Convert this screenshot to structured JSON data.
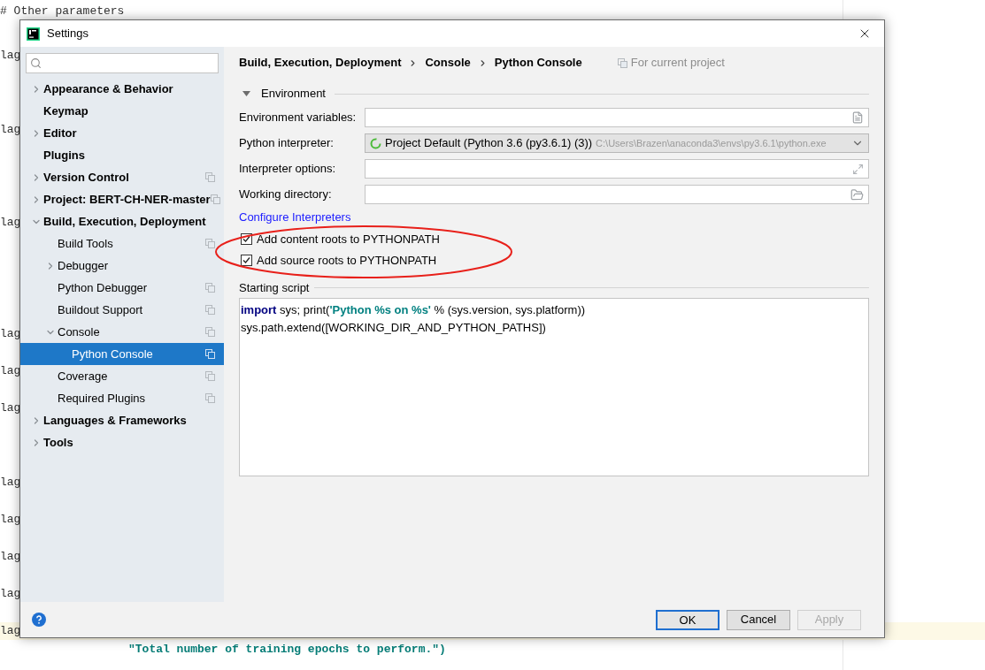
{
  "editor": {
    "lines": [
      {
        "text": "# Other parameters"
      },
      {
        "text": "lag"
      },
      {
        "text": "lag"
      },
      {
        "text": "lag"
      },
      {
        "text": "lag"
      },
      {
        "text": "lag"
      },
      {
        "text": "lag"
      },
      {
        "text": "lag"
      },
      {
        "text": "lag"
      },
      {
        "text": "lag"
      },
      {
        "text": "lag"
      },
      {
        "text": "lag",
        "current": true
      },
      {
        "text": "\"Total number of training epochs to perform.\")",
        "kind": "string"
      }
    ]
  },
  "dialog": {
    "title": "Settings",
    "sidebar": {
      "items": [
        {
          "label": "Appearance & Behavior",
          "expanded": false,
          "selected": false
        },
        {
          "label": "Keymap",
          "selected": false
        },
        {
          "label": "Editor",
          "expanded": false,
          "selected": false
        },
        {
          "label": "Plugins",
          "selected": false
        },
        {
          "label": "Version Control",
          "expanded": false,
          "project_scoped": true,
          "selected": false
        },
        {
          "label": "Project: BERT-CH-NER-master",
          "expanded": false,
          "project_scoped": true,
          "selected": false
        },
        {
          "label": "Build, Execution, Deployment",
          "expanded": true,
          "selected": false,
          "children": [
            {
              "label": "Build Tools",
              "project_scoped": true,
              "selected": false
            },
            {
              "label": "Debugger",
              "expanded": false,
              "selected": false
            },
            {
              "label": "Python Debugger",
              "project_scoped": true,
              "selected": false
            },
            {
              "label": "Buildout Support",
              "project_scoped": true,
              "selected": false
            },
            {
              "label": "Console",
              "expanded": true,
              "project_scoped": true,
              "selected": false,
              "children": [
                {
                  "label": "Python Console",
                  "project_scoped": true,
                  "selected": true
                }
              ]
            },
            {
              "label": "Coverage",
              "project_scoped": true,
              "selected": false
            },
            {
              "label": "Required Plugins",
              "project_scoped": true,
              "selected": false
            }
          ]
        },
        {
          "label": "Languages & Frameworks",
          "expanded": false,
          "selected": false
        },
        {
          "label": "Tools",
          "expanded": false,
          "selected": false
        }
      ]
    },
    "breadcrumb": [
      "Build, Execution, Deployment",
      "Console",
      "Python Console"
    ],
    "scope": "For current project",
    "section": {
      "title": "Environment",
      "expanded": true
    },
    "fields": [
      {
        "label": "Environment variables:",
        "kind": "text"
      },
      {
        "label": "Python interpreter:",
        "kind": "select",
        "value": "Project Default (Python 3.6 (py3.6.1) (3))",
        "detail": "C:\\Users\\Brazen\\anaconda3\\envs\\py3.6.1\\python.exe"
      },
      {
        "label": "Interpreter options:",
        "kind": "expand"
      },
      {
        "label": "Working directory:",
        "kind": "folder"
      }
    ],
    "link": "Configure Interpreters",
    "checkboxes": [
      {
        "label": "Add content roots to PYTHONPATH",
        "checked": true
      },
      {
        "label": "Add source roots to PYTHONPATH",
        "checked": true
      }
    ],
    "script": {
      "label": "Starting script",
      "lines": [
        [
          {
            "text": "import",
            "kind": "keyword"
          },
          {
            "text": " sys; print(",
            "kind": "plain"
          },
          {
            "text": "'Python %s on %s'",
            "kind": "string"
          },
          {
            "text": " % (sys.version, sys.platform))",
            "kind": "plain"
          }
        ],
        [
          {
            "text": "sys.path.extend([WORKING_DIR_AND_PYTHON_PATHS])",
            "kind": "plain"
          }
        ]
      ]
    },
    "buttons": [
      {
        "label": "OK",
        "default": true,
        "disabled": false
      },
      {
        "label": "Cancel",
        "default": false,
        "disabled": false
      },
      {
        "label": "Apply",
        "default": false,
        "disabled": true
      }
    ]
  }
}
